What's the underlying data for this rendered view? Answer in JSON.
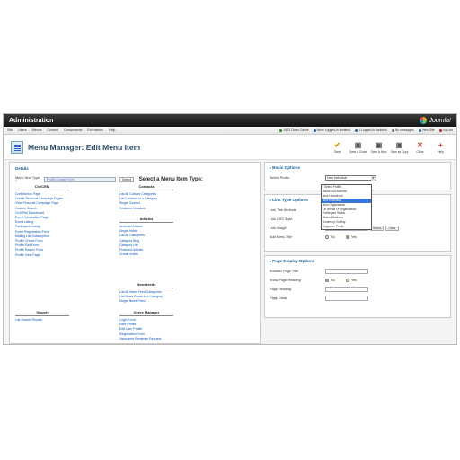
{
  "titlebar": {
    "title": "Administration",
    "logo_text": "Joomla!"
  },
  "menubar": {
    "items": [
      "Site",
      "Users",
      "Menus",
      "Content",
      "Components",
      "Extensions",
      "Help"
    ],
    "status": [
      {
        "label": "JAT3 Clean Cache",
        "color": "#2a8a2a"
      },
      {
        "label": "None Logged-in frontend",
        "color": "#2266aa"
      },
      {
        "label": "1 Logged-in backend",
        "color": "#2266aa"
      },
      {
        "label": "No messages",
        "color": "#777777"
      },
      {
        "label": "View Site",
        "color": "#2266aa"
      },
      {
        "label": "Log out",
        "color": "#cc2222"
      }
    ]
  },
  "header": {
    "title": "Menu Manager: Edit Menu Item"
  },
  "toolbar": [
    {
      "icon": "save-icon",
      "glyph": "✔",
      "color": "#e38a00",
      "label": "Save"
    },
    {
      "icon": "save-close-icon",
      "glyph": "▣",
      "color": "#555555",
      "label": "Save & Close"
    },
    {
      "icon": "save-new-icon",
      "glyph": "▣",
      "color": "#555555",
      "label": "Save & New"
    },
    {
      "icon": "save-copy-icon",
      "glyph": "▣",
      "color": "#555555",
      "label": "Save as Copy"
    },
    {
      "icon": "close-icon",
      "glyph": "✕",
      "color": "#d13a1e",
      "label": "Close"
    },
    {
      "icon": "help-icon",
      "glyph": "+",
      "color": "#d13a1e",
      "label": "Help"
    }
  ],
  "details": {
    "title": "Details",
    "menu_item_type_label": "Menu Item Type *",
    "menu_item_type_value": "Profile Create Form",
    "select_button": "Select",
    "chooser_heading": "Select a Menu Item Type:"
  },
  "groups": {
    "civicrm": {
      "title": "CiviCRM",
      "items": [
        "Contribution Page",
        "Create Personal Campaign Pages",
        "View Personal Campaign Page",
        "Custom Search",
        "CiviCRM Dashboard",
        "Event Information Page",
        "Event Listing",
        "Participant Listing",
        "Event Registration Form",
        "Mailing List Subscription",
        "Profile Create Form",
        "Profile Edit Form",
        "Profile Search Form",
        "Profile View Page"
      ]
    },
    "contacts": {
      "title": "Contacts",
      "items": [
        "List All Contact Categories",
        "List Contacts in a Category",
        "Single Contact",
        "Featured Contacts"
      ]
    },
    "articles": {
      "title": "Articles",
      "items": [
        "Archived Articles",
        "Single Article",
        "List All Categories",
        "Category Blog",
        "Category List",
        "Featured Articles",
        "Create Article"
      ]
    },
    "newsfeeds": {
      "title": "Newsfeeds",
      "items": [
        "List All News Feed Categories",
        "List News Feeds in a Category",
        "Single News Feed"
      ]
    },
    "search": {
      "title": "Search",
      "items": [
        "List Search Results"
      ]
    },
    "users": {
      "title": "Users Manager",
      "items": [
        "Login Form",
        "User Profile",
        "Edit User Profile",
        "Registration Form",
        "Username Reminder Request"
      ]
    }
  },
  "basic_options": {
    "title": "Basic Options",
    "select_profile_label": "Select Profile",
    "selected": "New Individual",
    "options": [
      "- Select Profile -",
      "Name and Address",
      "New Household",
      "New Individual",
      "New Organization",
      "On Behalf Of Organization",
      "Participant Status",
      "Shared Address",
      "Summary Overlay",
      "Supporter Profile"
    ],
    "highlighted_index": 3
  },
  "link_type": {
    "title": "Link Type Options",
    "title_attr_label": "Link Title Attribute",
    "css_style_label": "Link CSS Style",
    "link_image_label": "Link Image",
    "select_button": "Select",
    "clear_button": "Clear",
    "add_title_label": "Add Menu Title",
    "no": "No",
    "yes": "Yes"
  },
  "page_display": {
    "title": "Page Display Options",
    "browser_title_label": "Browser Page Title",
    "show_heading_label": "Show Page Heading",
    "no": "No",
    "yes": "Yes",
    "page_heading_label": "Page Heading",
    "page_class_label": "Page Class"
  }
}
